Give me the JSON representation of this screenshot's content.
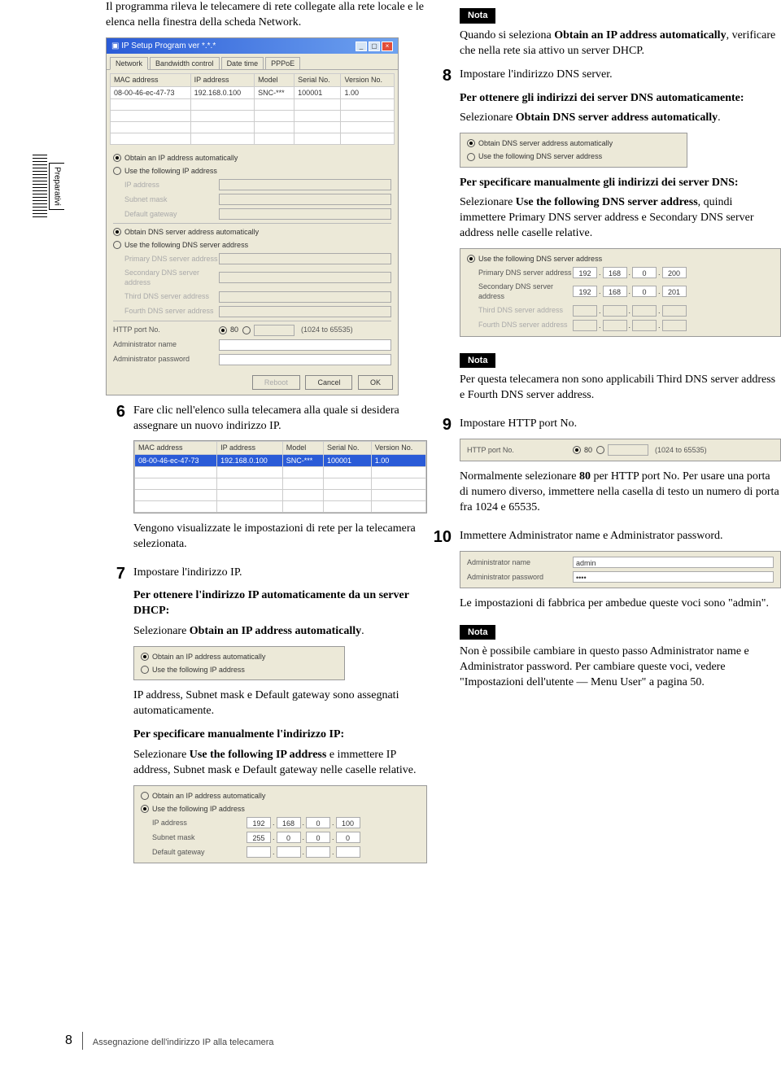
{
  "sideTab": "Preparativi",
  "footer": {
    "page": "8",
    "title": "Assegnazione dell'indirizzo IP alla telecamera"
  },
  "left": {
    "intro": "Il programma rileva le telecamere di rete collegate alla rete locale e le elenca nella finestra della scheda Network.",
    "win": {
      "title": "IP Setup Program ver *.*.*",
      "tabs": [
        "Network",
        "Bandwidth control",
        "Date time",
        "PPPoE"
      ],
      "headers": [
        "MAC address",
        "IP address",
        "Model",
        "Serial No.",
        "Version No."
      ],
      "row": [
        "08-00-46-ec-47-73",
        "192.168.0.100",
        "SNC-***",
        "100001",
        "1.00"
      ],
      "opt1": "Obtain an IP address automatically",
      "opt2": "Use the following IP address",
      "ipaddr": "IP address",
      "subnet": "Subnet mask",
      "gateway": "Default gateway",
      "opt3": "Obtain DNS server address automatically",
      "opt4": "Use the following DNS server address",
      "pdns": "Primary DNS server address",
      "sdns": "Secondary DNS server address",
      "tdns": "Third DNS server address",
      "fdns": "Fourth DNS server address",
      "http": "HTTP port No.",
      "port80": "80",
      "portRange": "(1024 to 65535)",
      "aname": "Administrator name",
      "apass": "Administrator password",
      "reboot": "Reboot",
      "cancel": "Cancel",
      "ok": "OK"
    },
    "s6": "Fare clic nell'elenco sulla telecamera alla quale si desidera assegnare un nuovo indirizzo IP.",
    "s6after": "Vengono visualizzate le impostazioni di rete per la telecamera selezionata.",
    "s7": "Impostare l'indirizzo IP.",
    "s7h1": "Per ottenere l'indirizzo IP automaticamente da un server DHCP:",
    "s7t1a": "Selezionare ",
    "s7t1b": "Obtain an IP address automatically",
    "s7t1c": ".",
    "s7fig1": {
      "opt1": "Obtain an IP address automatically",
      "opt2": "Use the following IP address"
    },
    "s7t2": "IP address, Subnet mask e Default gateway sono assegnati automaticamente.",
    "s7h2": "Per specificare manualmente l'indirizzo IP:",
    "s7t3a": "Selezionare ",
    "s7t3b": "Use the following IP address",
    "s7t3c": " e immettere IP address, Subnet mask e Default gateway nelle caselle relative.",
    "s7fig2": {
      "opt1": "Obtain an IP address automatically",
      "opt2": "Use the following IP address",
      "ipaddr": "IP address",
      "ip": [
        "192",
        "168",
        "0",
        "100"
      ],
      "subnet": "Subnet mask",
      "sm": [
        "255",
        "0",
        "0",
        "0"
      ],
      "gateway": "Default gateway"
    }
  },
  "right": {
    "nota1": "Nota",
    "nota1t_a": "Quando si seleziona ",
    "nota1t_b": "Obtain an IP address automatically",
    "nota1t_c": ", verificare che nella rete sia attivo un server DHCP.",
    "s8": "Impostare l'indirizzo DNS server.",
    "s8h1": "Per ottenere gli indirizzi dei server DNS automaticamente:",
    "s8t1a": "Selezionare ",
    "s8t1b": "Obtain DNS server address automatically",
    "s8t1c": ".",
    "s8fig1": {
      "opt1": "Obtain DNS server address automatically",
      "opt2": "Use the following DNS server address"
    },
    "s8h2": "Per specificare manualmente gli indirizzi dei server DNS:",
    "s8t2a": "Selezionare ",
    "s8t2b": "Use the following DNS server address",
    "s8t2c": ", quindi immettere Primary DNS server address e Secondary DNS server address nelle caselle relative.",
    "s8fig2": {
      "opt": "Use the following DNS server address",
      "pdns": "Primary DNS server address",
      "p": [
        "192",
        "168",
        "0",
        "200"
      ],
      "sdns": "Secondary DNS server address",
      "s": [
        "192",
        "168",
        "0",
        "201"
      ],
      "tdns": "Third DNS server address",
      "fdns": "Fourth DNS server address"
    },
    "nota2": "Nota",
    "nota2t": "Per questa telecamera non sono applicabili Third DNS server address e Fourth DNS server address.",
    "s9": "Impostare HTTP port No.",
    "s9fig": {
      "label": "HTTP port No.",
      "p80": "80",
      "range": "(1024 to 65535)"
    },
    "s9t_a": "Normalmente selezionare ",
    "s9t_b": "80",
    "s9t_c": " per HTTP port No. Per usare una porta di numero diverso, immettere nella casella di testo un numero di porta fra 1024 e 65535.",
    "s10": "Immettere Administrator name e Administrator password.",
    "s10fig": {
      "aname": "Administrator name",
      "av": "admin",
      "apass": "Administrator password",
      "pv": "••••"
    },
    "s10t": "Le impostazioni di fabbrica per ambedue queste voci sono \"admin\".",
    "nota3": "Nota",
    "nota3t": "Non è possibile cambiare in questo passo Administrator name e Administrator password. Per cambiare queste voci, vedere \"Impostazioni dell'utente — Menu User\" a pagina 50."
  }
}
